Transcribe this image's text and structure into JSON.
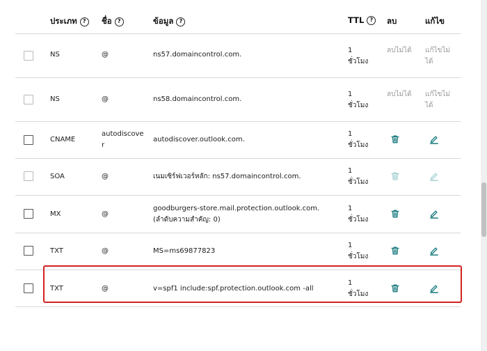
{
  "header": {
    "type": "ประเภท",
    "name": "ชื่อ",
    "data": "ข้อมูล",
    "ttl": "TTL",
    "delete": "ลบ",
    "edit": "แก้ไข",
    "help_glyph": "?"
  },
  "rows": [
    {
      "type": "NS",
      "name": "@",
      "data": "ns57.domaincontrol.com.",
      "ttl_num": "1",
      "ttl_unit": "ชั่วโมง",
      "delete_text": "ลบไม่ได้",
      "edit_text": "แก้ไขไม่ได้"
    },
    {
      "type": "NS",
      "name": "@",
      "data": "ns58.domaincontrol.com.",
      "ttl_num": "1",
      "ttl_unit": "ชั่วโมง",
      "delete_text": "ลบไม่ได้",
      "edit_text": "แก้ไขไม่ได้"
    },
    {
      "type": "CNAME",
      "name": "autodiscover",
      "data": "autodiscover.outlook.com.",
      "ttl_num": "1",
      "ttl_unit": "ชั่วโมง"
    },
    {
      "type": "SOA",
      "name": "@",
      "data": "เนมเซิร์ฟเวอร์หลัก: ns57.domaincontrol.com.",
      "ttl_num": "1",
      "ttl_unit": "ชั่วโมง"
    },
    {
      "type": "MX",
      "name": "@",
      "data": "goodburgers-store.mail.protection.outlook.com. (ลำดับความสำคัญ: 0)",
      "ttl_num": "1",
      "ttl_unit": "ชั่วโมง"
    },
    {
      "type": "TXT",
      "name": "@",
      "data": "MS=ms69877823",
      "ttl_num": "1",
      "ttl_unit": "ชั่วโมง"
    },
    {
      "type": "TXT",
      "name": "@",
      "data": "v=spf1 include:spf.protection.outlook.com -all",
      "ttl_num": "1",
      "ttl_unit": "ชั่วโมง"
    }
  ],
  "icons": {
    "delete": "trash-icon",
    "edit": "pencil-icon",
    "help": "question-circle-icon"
  },
  "colors": {
    "action_teal": "#1b7c80",
    "disabled_teal": "#a9d2d3",
    "highlight_red": "#d42020"
  }
}
